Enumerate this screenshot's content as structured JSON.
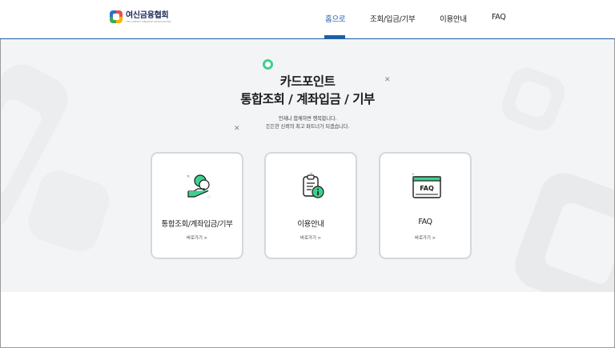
{
  "header": {
    "logo_title": "여신금융협회",
    "logo_subtitle": "THE CREDIT FINANCE ASSOCIATION",
    "nav": [
      {
        "label": "홈으로",
        "active": true
      },
      {
        "label": "조회/입금/기부",
        "active": false
      },
      {
        "label": "이용안내",
        "active": false
      },
      {
        "label": "FAQ",
        "active": false
      }
    ],
    "active_color": "#1f5fa8"
  },
  "hero": {
    "title_line1": "카드포인트",
    "title_line2": "통합조회 / 계좌입금 / 기부",
    "desc_line1": "언제나 함께하면 행복합니다.",
    "desc_line2": "든든한 신뢰의 최고 파트너가 되겠습니다.",
    "accent_color": "#3fcf8e"
  },
  "cards": [
    {
      "label": "통합조회/계좌입금/기부",
      "link": "바로가기 >",
      "icon": "coin-hand-icon"
    },
    {
      "label": "이용안내",
      "link": "바로가기 >",
      "icon": "clipboard-info-icon"
    },
    {
      "label": "FAQ",
      "link": "바로가기 >",
      "icon": "faq-window-icon",
      "icon_text": "FAQ"
    }
  ]
}
